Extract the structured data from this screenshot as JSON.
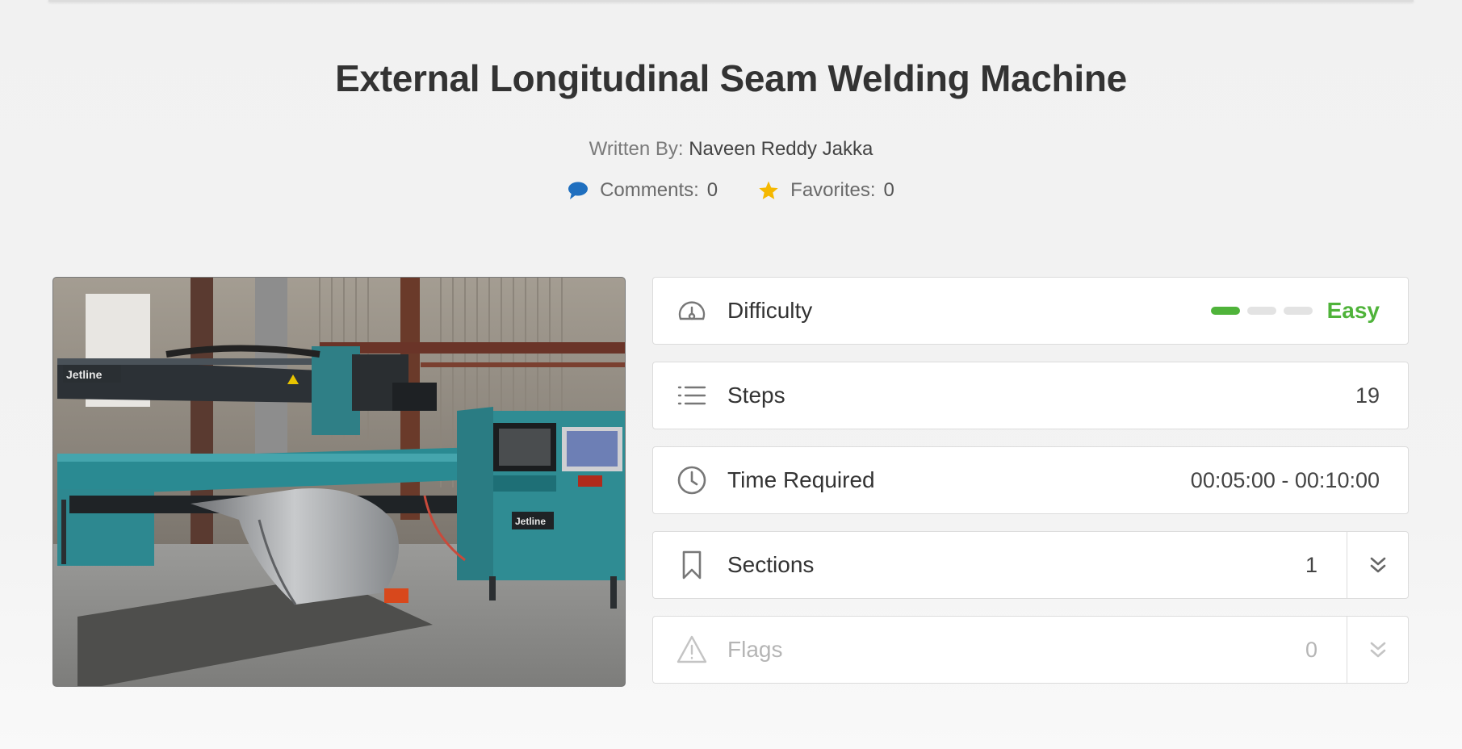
{
  "title": "External Longitudinal Seam Welding Machine",
  "byline": {
    "prefix": "Written By:",
    "author": "Naveen Reddy Jakka"
  },
  "stats": {
    "comments_label": "Comments:",
    "comments_count": "0",
    "favorites_label": "Favorites:",
    "favorites_count": "0"
  },
  "hero_image": {
    "brand_text_1": "Jetline",
    "brand_text_2": "Jetline"
  },
  "details": {
    "difficulty": {
      "label": "Difficulty",
      "value": "Easy",
      "level": 1,
      "max_level": 3
    },
    "steps": {
      "label": "Steps",
      "value": "19"
    },
    "time": {
      "label": "Time Required",
      "value": "00:05:00 - 00:10:00"
    },
    "sections": {
      "label": "Sections",
      "value": "1"
    },
    "flags": {
      "label": "Flags",
      "value": "0"
    }
  },
  "colors": {
    "accent_green": "#4fb33a",
    "comment_blue": "#1f6fbf",
    "star_yellow": "#f5b800"
  },
  "icons": {
    "comments": "speech-bubble-icon",
    "favorites": "star-icon",
    "difficulty": "gauge-icon",
    "steps": "list-icon",
    "time": "clock-icon",
    "sections": "bookmark-icon",
    "flags": "warning-triangle-icon",
    "expand": "double-chevron-down-icon"
  }
}
